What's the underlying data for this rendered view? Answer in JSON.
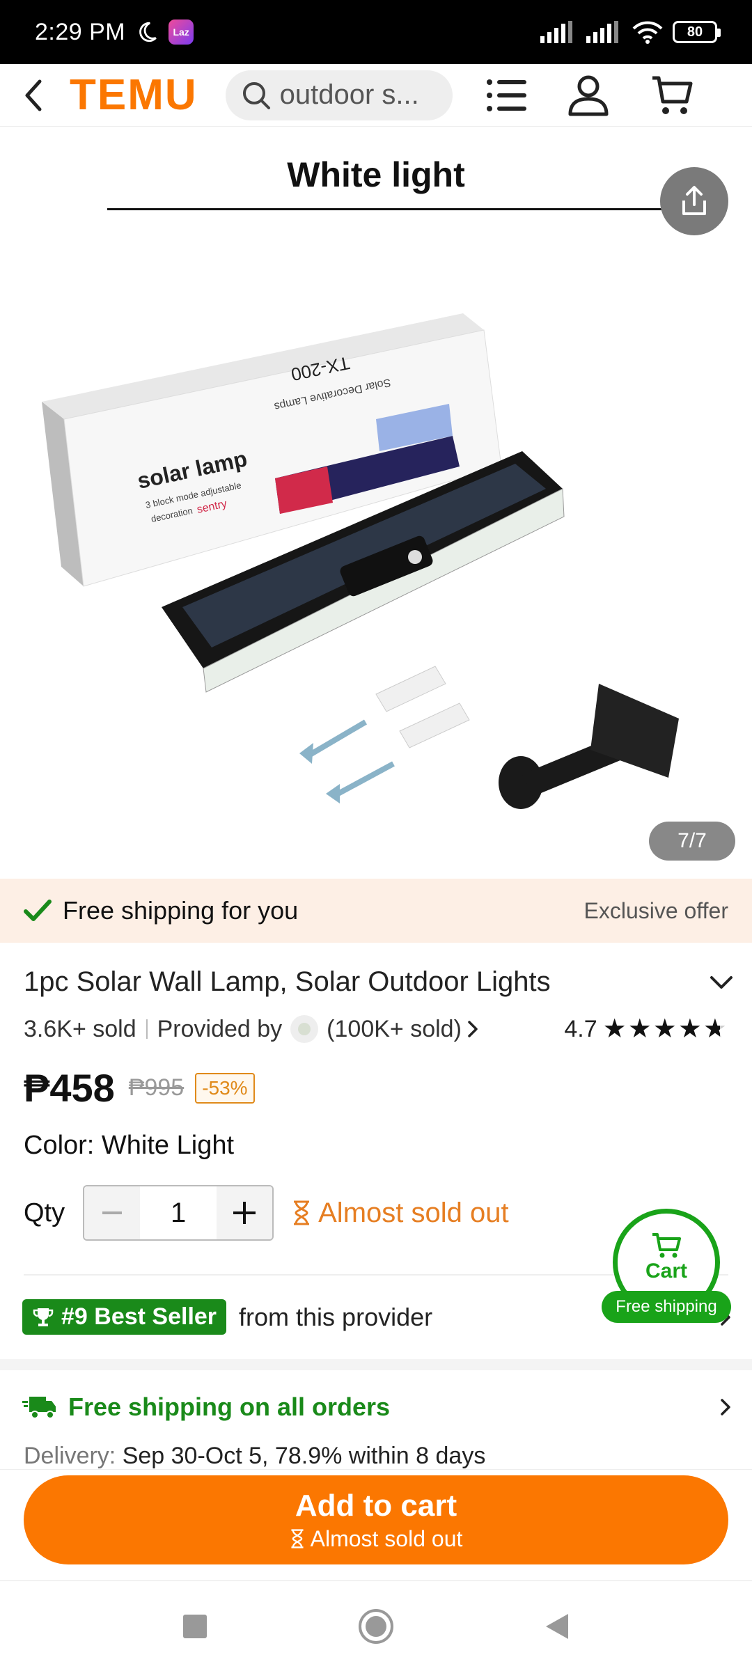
{
  "status_bar": {
    "time": "2:29 PM",
    "battery": "80",
    "app_badge": "Laz"
  },
  "header": {
    "logo": "TEMU",
    "search_text": "outdoor s...",
    "icons": [
      "back-arrow-icon",
      "search-icon",
      "list-menu-icon",
      "account-icon",
      "cart-icon"
    ]
  },
  "gallery": {
    "image_title": "White light",
    "counter": "7/7",
    "box_text": "solar lamp",
    "box_subtext": "3 block mode adjustable",
    "box_subtext2": "decoration",
    "box_brand": "sentry",
    "box_model": "TX-200",
    "box_model_sub": "Solar Decorative Lamps"
  },
  "shipping_strip": {
    "label": "Free shipping for you",
    "offer": "Exclusive offer"
  },
  "product": {
    "title": "1pc Solar Wall Lamp, Solar Outdoor Lights",
    "sold": "3.6K+ sold",
    "provided_by": "Provided by",
    "provider_sold": "(100K+ sold)",
    "rating": "4.7",
    "rating_value": 4.7,
    "price": "₱458",
    "original_price": "₱995",
    "discount": "-53%",
    "color": "Color: White Light",
    "qty_label": "Qty",
    "qty_value": "1",
    "stock_status": "Almost sold out"
  },
  "best_seller": {
    "badge": "#9 Best Seller",
    "text": "from this provider"
  },
  "shipping_all": {
    "label": "Free shipping on all orders",
    "delivery_label": "Delivery:",
    "delivery_value": "Sep 30-Oct 5, 78.9% within 8 days"
  },
  "floating_cart": {
    "label": "Cart",
    "tag": "Free shipping"
  },
  "action_bar": {
    "button_label": "Add to cart",
    "button_sub": "Almost sold out"
  },
  "colors": {
    "brand_orange": "#fb7701",
    "success_green": "#1a8a1a",
    "warning_orange": "#e67e22"
  }
}
